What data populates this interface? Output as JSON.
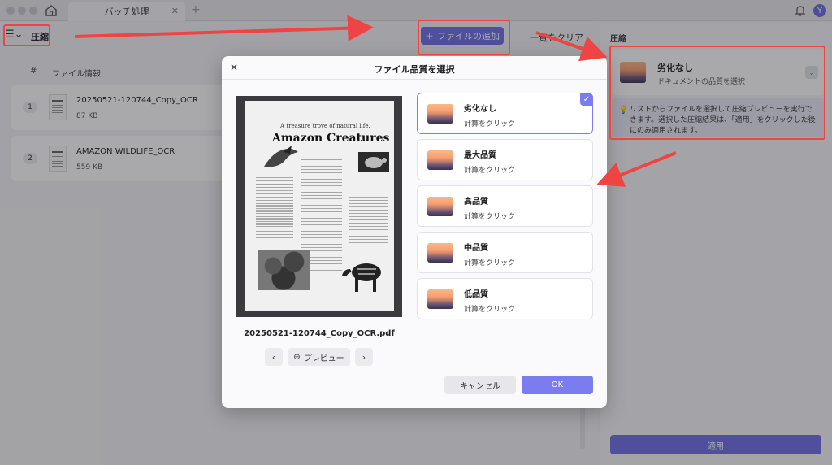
{
  "window": {
    "tab_title": "バッチ処理",
    "avatar_initial": "Y"
  },
  "toolbar": {
    "page_title": "圧縮",
    "add_file_label": "ファイルの追加",
    "clear_list_label": "一覧をクリア"
  },
  "file_list": {
    "col_num": "#",
    "col_info": "ファイル情報",
    "rows": [
      {
        "num": "1",
        "name": "20250521-120744_Copy_OCR",
        "size": "87 KB"
      },
      {
        "num": "2",
        "name": "AMAZON WILDLIFE_OCR",
        "size": "559 KB"
      }
    ]
  },
  "right_panel": {
    "label": "圧縮",
    "selected_title": "劣化なし",
    "selected_sub": "ドキュメントの品質を選択",
    "info_text": "リストからファイルを選択して圧縮プレビューを実行できます。選択した圧縮結果は、「適用」をクリックした後にのみ適用されます。",
    "apply_label": "適用"
  },
  "dialog": {
    "title": "ファイル品質を選択",
    "preview_doc": {
      "subtitle": "A treasure trove of natural life.",
      "title": "Amazon Creatures"
    },
    "file_name": "20250521-120744_Copy_OCR.pdf",
    "preview_label": "プレビュー",
    "options": [
      {
        "title": "劣化なし",
        "sub": "計算をクリック",
        "selected": true
      },
      {
        "title": "最大品質",
        "sub": "計算をクリック",
        "selected": false
      },
      {
        "title": "高品質",
        "sub": "計算をクリック",
        "selected": false
      },
      {
        "title": "中品質",
        "sub": "計算をクリック",
        "selected": false
      },
      {
        "title": "低品質",
        "sub": "計算をクリック",
        "selected": false
      }
    ],
    "cancel_label": "キャンセル",
    "ok_label": "OK"
  },
  "colors": {
    "accent": "#6e6fe8",
    "annotation_red": "#ee4444"
  }
}
